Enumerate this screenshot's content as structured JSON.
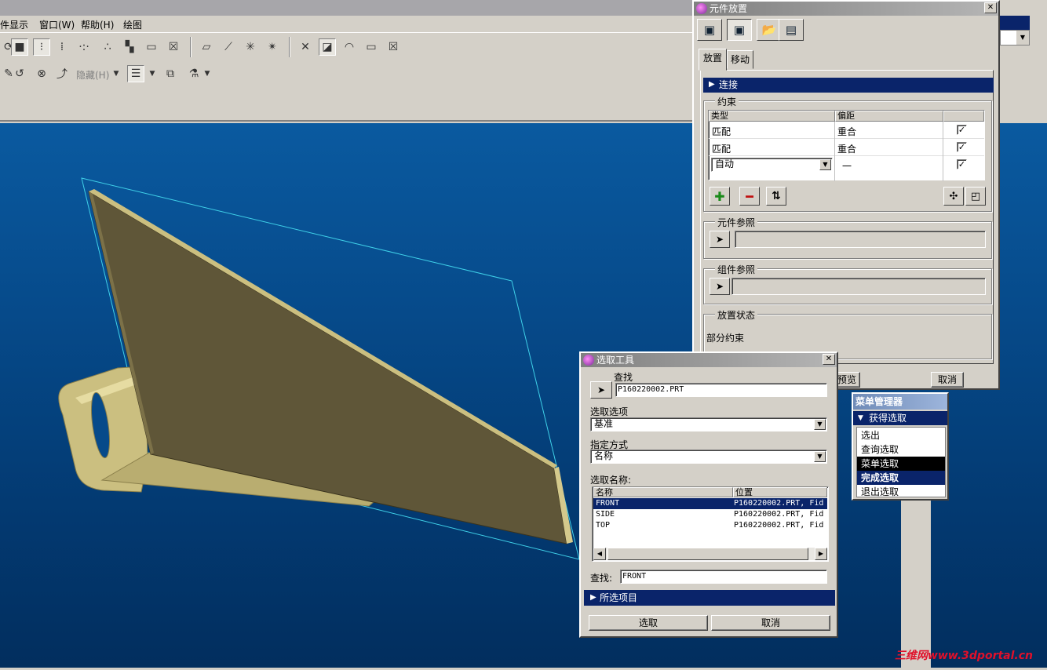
{
  "menubar": {
    "items": [
      "件显示",
      "窗口(W)",
      "帮助(H)",
      "绘图"
    ]
  },
  "toolbar": {
    "hide_label": "隐藏(H)"
  },
  "component_placement": {
    "title": "元件放置",
    "tabs": [
      "放置",
      "移动"
    ],
    "connect_label": "连接",
    "constraints_group": "约束",
    "col_type": "类型",
    "col_offset": "偏距",
    "rows": [
      {
        "type": "匹配",
        "offset": "重合",
        "checked": "✓"
      },
      {
        "type": "匹配",
        "offset": "重合",
        "checked": "✓"
      },
      {
        "type": "自动",
        "offset": "一",
        "checked": "✓"
      }
    ],
    "component_ref_group": "元件参照",
    "assembly_ref_group": "组件参照",
    "placement_status_group": "放置状态",
    "status_text": "部分约束",
    "preview_button": "预览",
    "cancel_button": "取消"
  },
  "select_tool": {
    "title": "选取工具",
    "find_label": "查找",
    "find_value": "P160220002.PRT",
    "select_option_label": "选取选项",
    "select_option_value": "基准",
    "specify_label": "指定方式",
    "specify_value": "名称",
    "select_name_label": "选取名称:",
    "col_name": "名称",
    "col_location": "位置",
    "items": [
      {
        "name": "FRONT",
        "location": "P160220002.PRT, Fid"
      },
      {
        "name": "SIDE",
        "location": "P160220002.PRT, Fid"
      },
      {
        "name": "TOP",
        "location": "P160220002.PRT, Fid"
      }
    ],
    "search_label": "查找:",
    "search_value": "FRONT",
    "selected_items_label": "所选项目",
    "select_button": "选取",
    "cancel_button": "取消"
  },
  "menu_manager": {
    "title": "菜单管理器",
    "submenu": "获得选取",
    "items": [
      "选出",
      "查询选取",
      "菜单选取",
      "完成选取",
      "退出选取"
    ]
  },
  "watermark": "三维网www.3dportal.cn",
  "colors": {
    "viewport_bg": "#06488a",
    "part_face": "#5f5638",
    "part_edge": "#cbbf80",
    "plane_outline": "#3fd0e8",
    "selection_blue": "#0a246a"
  }
}
